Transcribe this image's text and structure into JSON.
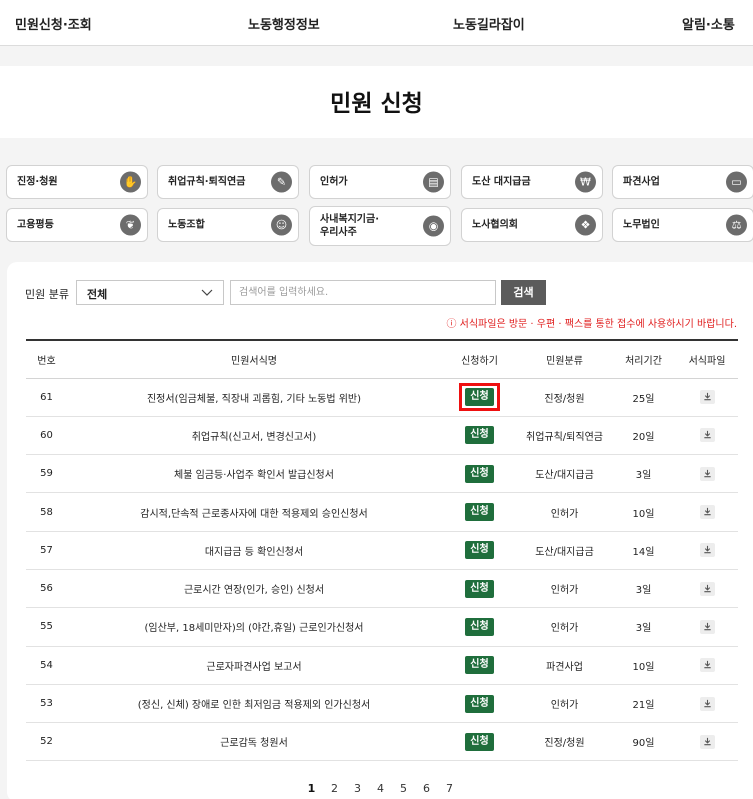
{
  "nav": {
    "items": [
      "민원신청·조회",
      "노동행정정보",
      "노동길라잡이",
      "알림·소통"
    ]
  },
  "page_title": "민원 신청",
  "categories": [
    {
      "label": "진정·청원",
      "icon": "document-hand-icon"
    },
    {
      "label": "취업규칙·퇴직연금",
      "icon": "document-edit-icon"
    },
    {
      "label": "인허가",
      "icon": "document-stamp-icon"
    },
    {
      "label": "도산 대지급금",
      "icon": "money-icon"
    },
    {
      "label": "파견사업",
      "icon": "briefcase-icon"
    },
    {
      "label": "고용평등",
      "icon": "handshake-icon"
    },
    {
      "label": "노동조합",
      "icon": "people-icon"
    },
    {
      "label": "사내복지기금·\n우리사주",
      "icon": "coin-hand-icon"
    },
    {
      "label": "노사협의회",
      "icon": "meeting-icon"
    },
    {
      "label": "노무법인",
      "icon": "scales-icon"
    }
  ],
  "filter": {
    "label": "민원 분류",
    "selected": "전체",
    "search_placeholder": "검색어를 입력하세요.",
    "search_button": "검색"
  },
  "notice": "ⓘ 서식파일은 방문 · 우편 · 팩스를 통한 접수에 사용하시기 바랍니다.",
  "table": {
    "headers": [
      "번호",
      "민원서식명",
      "신청하기",
      "민원분류",
      "처리기간",
      "서식파일"
    ],
    "apply_label": "신청",
    "rows": [
      {
        "no": "61",
        "name": "진정서(임금체불, 직장내 괴롭힘, 기타 노동법 위반)",
        "category": "진정/청원",
        "period": "25일"
      },
      {
        "no": "60",
        "name": "취업규칙(신고서, 변경신고서)",
        "category": "취업규칙/퇴직연금",
        "period": "20일"
      },
      {
        "no": "59",
        "name": "체불 임금등·사업주 확인서 발급신청서",
        "category": "도산/대지급금",
        "period": "3일"
      },
      {
        "no": "58",
        "name": "감시적,단속적 근로종사자에 대한 적용제외 승인신청서",
        "category": "인허가",
        "period": "10일"
      },
      {
        "no": "57",
        "name": "대지급금 등 확인신청서",
        "category": "도산/대지급금",
        "period": "14일"
      },
      {
        "no": "56",
        "name": "근로시간 연장(인가, 승인) 신청서",
        "category": "인허가",
        "period": "3일"
      },
      {
        "no": "55",
        "name": "(임산부, 18세미만자)의 (야간,휴일) 근로인가신청서",
        "category": "인허가",
        "period": "3일"
      },
      {
        "no": "54",
        "name": "근로자파견사업 보고서",
        "category": "파견사업",
        "period": "10일"
      },
      {
        "no": "53",
        "name": "(정신, 신체) 장애로 인한 최저임금 적용제외 인가신청서",
        "category": "인허가",
        "period": "21일"
      },
      {
        "no": "52",
        "name": "근로감독 청원서",
        "category": "진정/청원",
        "period": "90일"
      }
    ]
  },
  "pagination": {
    "pages": [
      "1",
      "2",
      "3",
      "4",
      "5",
      "6",
      "7"
    ],
    "current": "1"
  },
  "colors": {
    "apply_green": "#1f6e3c",
    "highlight_red": "#ee1010",
    "notice_red": "#e01d1d",
    "search_button_gray": "#5b5b5b"
  }
}
